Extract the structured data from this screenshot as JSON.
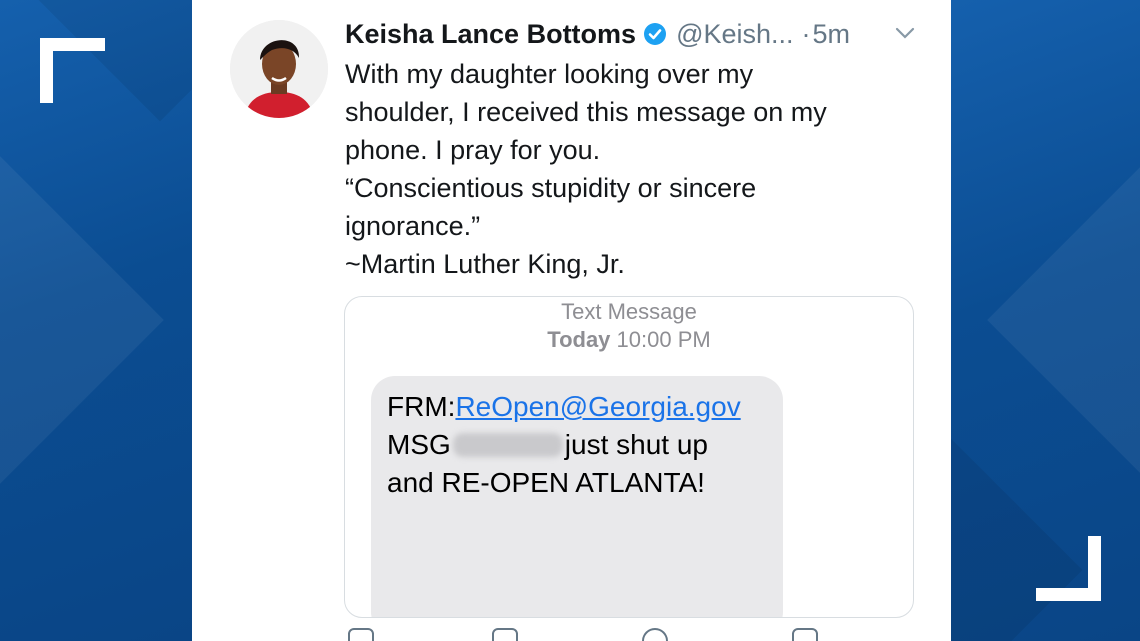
{
  "tweet": {
    "author_name": "Keisha Lance Bottoms",
    "handle": "@Keish...",
    "separator": "·",
    "time": "5m",
    "text_lines": [
      "With my daughter looking over my",
      "shoulder, I received this message on my",
      "phone. I pray for you.",
      "“Conscientious stupidity or sincere",
      "ignorance.”",
      "~Martin Luther King, Jr."
    ]
  },
  "message": {
    "service": "Text Message",
    "date_bold": "Today",
    "time": "10:00 PM",
    "from_prefix": "FRM:",
    "from_address": "ReOpen@Georgia.gov",
    "msg_prefix": "MSG",
    "msg_after_blur": "just shut up",
    "line3": "and RE-OPEN ATLANTA!"
  },
  "colors": {
    "brand_blue": "#0a4f93",
    "verified_blue": "#1da1f2",
    "link_blue": "#1a73e8",
    "bubble_gray": "#e9e9eb"
  },
  "icons": {
    "verified": "verified-badge-icon",
    "chevron": "chevron-down-icon",
    "reply": "reply-icon",
    "retweet": "retweet-icon",
    "like": "like-icon",
    "share": "share-icon"
  }
}
